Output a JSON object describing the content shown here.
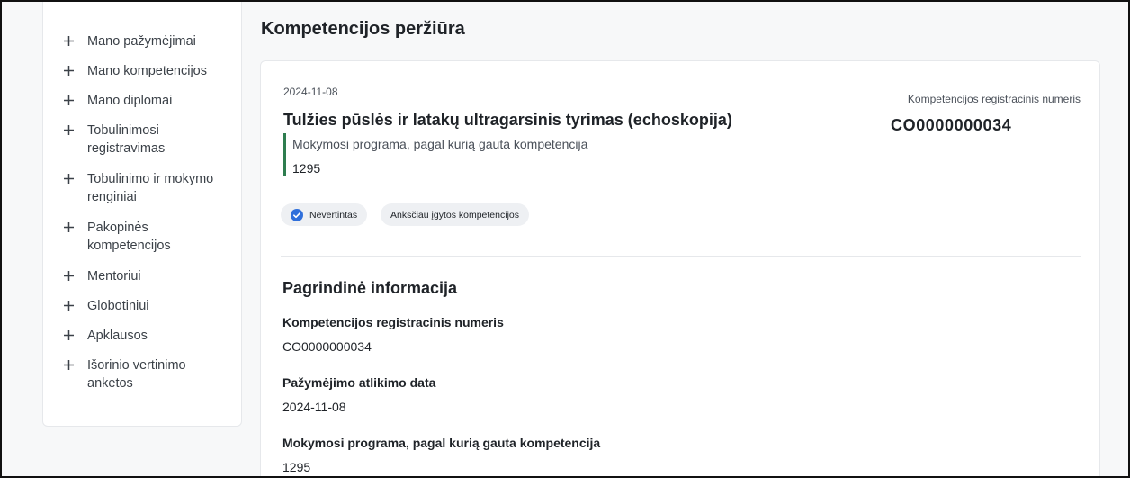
{
  "sidebar": {
    "items": [
      {
        "label": "Mano pažymėjimai"
      },
      {
        "label": "Mano kompetencijos"
      },
      {
        "label": "Mano diplomai"
      },
      {
        "label": "Tobulinimosi registravimas"
      },
      {
        "label": "Tobulinimo ir mokymo renginiai"
      },
      {
        "label": "Pakopinės kompetencijos"
      },
      {
        "label": "Mentoriui"
      },
      {
        "label": "Globotiniui"
      },
      {
        "label": "Apklausos"
      },
      {
        "label": "Išorinio vertinimo anketos"
      }
    ]
  },
  "page": {
    "title": "Kompetencijos peržiūra"
  },
  "card": {
    "date": "2024-11-08",
    "title": "Tulžies pūslės ir latakų ultragarsinis tyrimas (echoskopija)",
    "program_label": "Mokymosi programa, pagal kurią gauta kompetencija",
    "program_value": "1295",
    "reg_label": "Kompetencijos registracinis numeris",
    "reg_value": "CO0000000034",
    "badges": [
      {
        "label": "Nevertintas",
        "icon": "check-circle-icon"
      },
      {
        "label": "Anksčiau įgytos kompetencijos"
      }
    ]
  },
  "info": {
    "section_title": "Pagrindinė informacija",
    "fields": [
      {
        "label": "Kompetencijos registracinis numeris",
        "value": "CO0000000034"
      },
      {
        "label": "Pažymėjimo atlikimo data",
        "value": "2024-11-08"
      },
      {
        "label": "Mokymosi programa, pagal kurią gauta kompetencija",
        "value": "1295"
      }
    ]
  },
  "colors": {
    "accent_green": "#2e7d4f",
    "check_blue": "#2f6fdb",
    "badge_bg": "#eef0f3"
  }
}
